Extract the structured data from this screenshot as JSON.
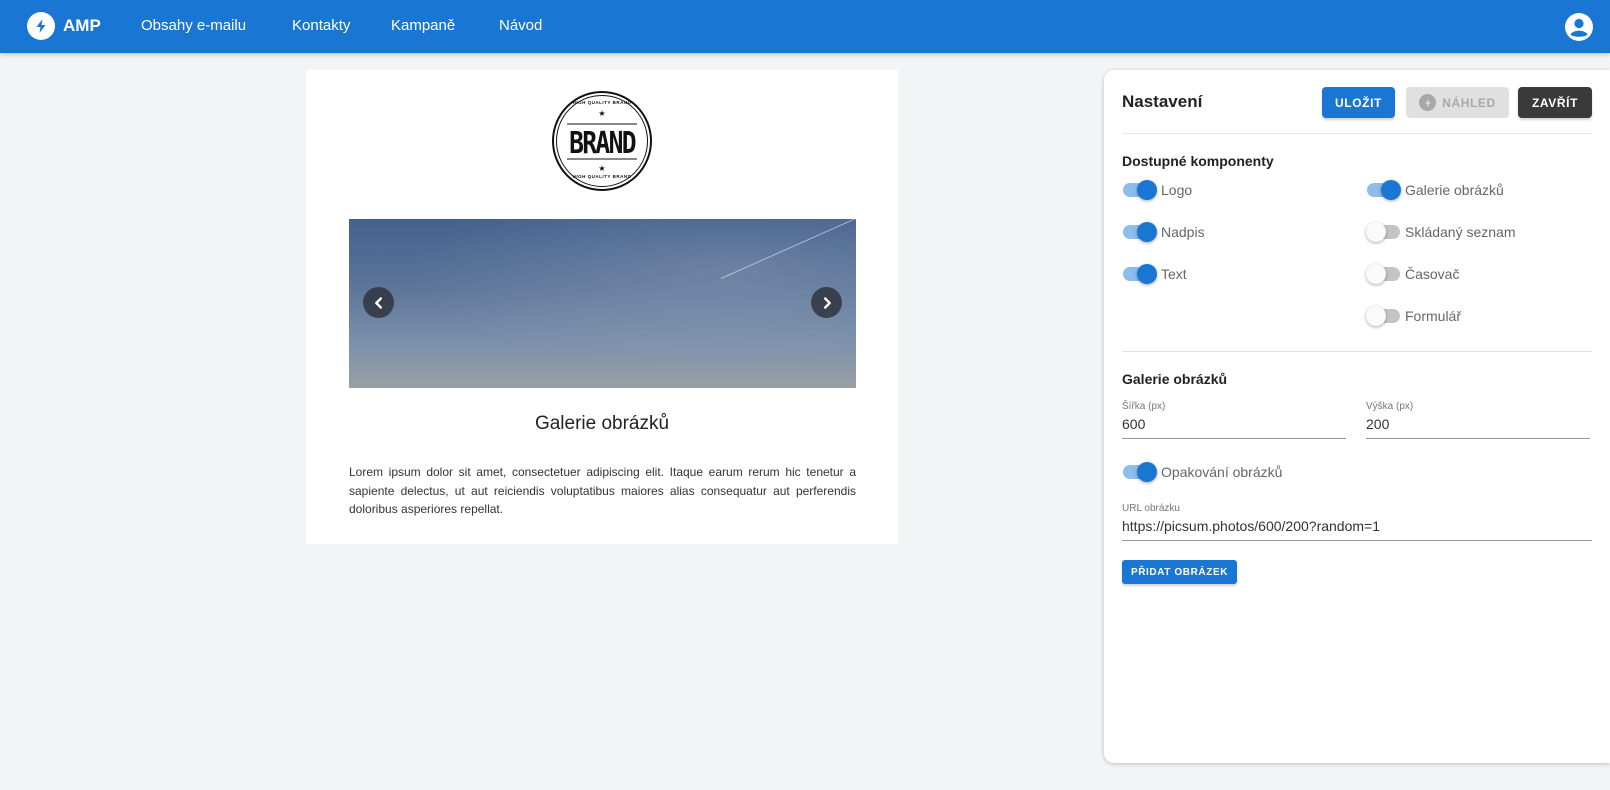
{
  "app": {
    "brand": "AMP",
    "nav": [
      "Obsahy e-mailu",
      "Kontakty",
      "Kampaně",
      "Návod"
    ]
  },
  "preview": {
    "logo": {
      "main": "BRAND",
      "arc_top": "HIGH QUALITY BRAND",
      "arc_bottom": "HIGH QUALITY BRAND",
      "star": "★"
    },
    "heading": "Galerie obrázků",
    "text": "Lorem ipsum dolor sit amet, consectetuer adipiscing elit. Itaque earum rerum hic tenetur a sapiente delectus, ut aut reiciendis voluptatibus maiores alias consequatur aut perferendis doloribus asperiores repellat."
  },
  "settings": {
    "title": "Nastavení",
    "save_label": "ULOŽIT",
    "preview_label": "NÁHLED",
    "close_label": "ZAVŘÍT",
    "components_title": "Dostupné komponenty",
    "components": [
      {
        "label": "Logo",
        "enabled": true
      },
      {
        "label": "Nadpis",
        "enabled": true
      },
      {
        "label": "Text",
        "enabled": true
      },
      {
        "label": "Galerie obrázků",
        "enabled": true
      },
      {
        "label": "Skládaný seznam",
        "enabled": false
      },
      {
        "label": "Časovač",
        "enabled": false
      },
      {
        "label": "Formulář",
        "enabled": false
      }
    ],
    "gallery": {
      "title": "Galerie obrázků",
      "width_label": "Šířka (px)",
      "width_value": "600",
      "height_label": "Výška (px)",
      "height_value": "200",
      "loop_label": "Opakování obrázků",
      "loop_enabled": true,
      "url_label": "URL obrázku",
      "url_value": "https://picsum.photos/600/200?random=1",
      "add_label": "PŘIDAT OBRÁZEK"
    }
  },
  "colors": {
    "primary": "#1976d2",
    "dark_button": "#3a3a3a",
    "background": "#f3f4f6"
  },
  "icons": {
    "brand": "bolt-icon",
    "account": "account-circle-icon",
    "prev": "chevron-left-icon",
    "next": "chevron-right-icon"
  }
}
